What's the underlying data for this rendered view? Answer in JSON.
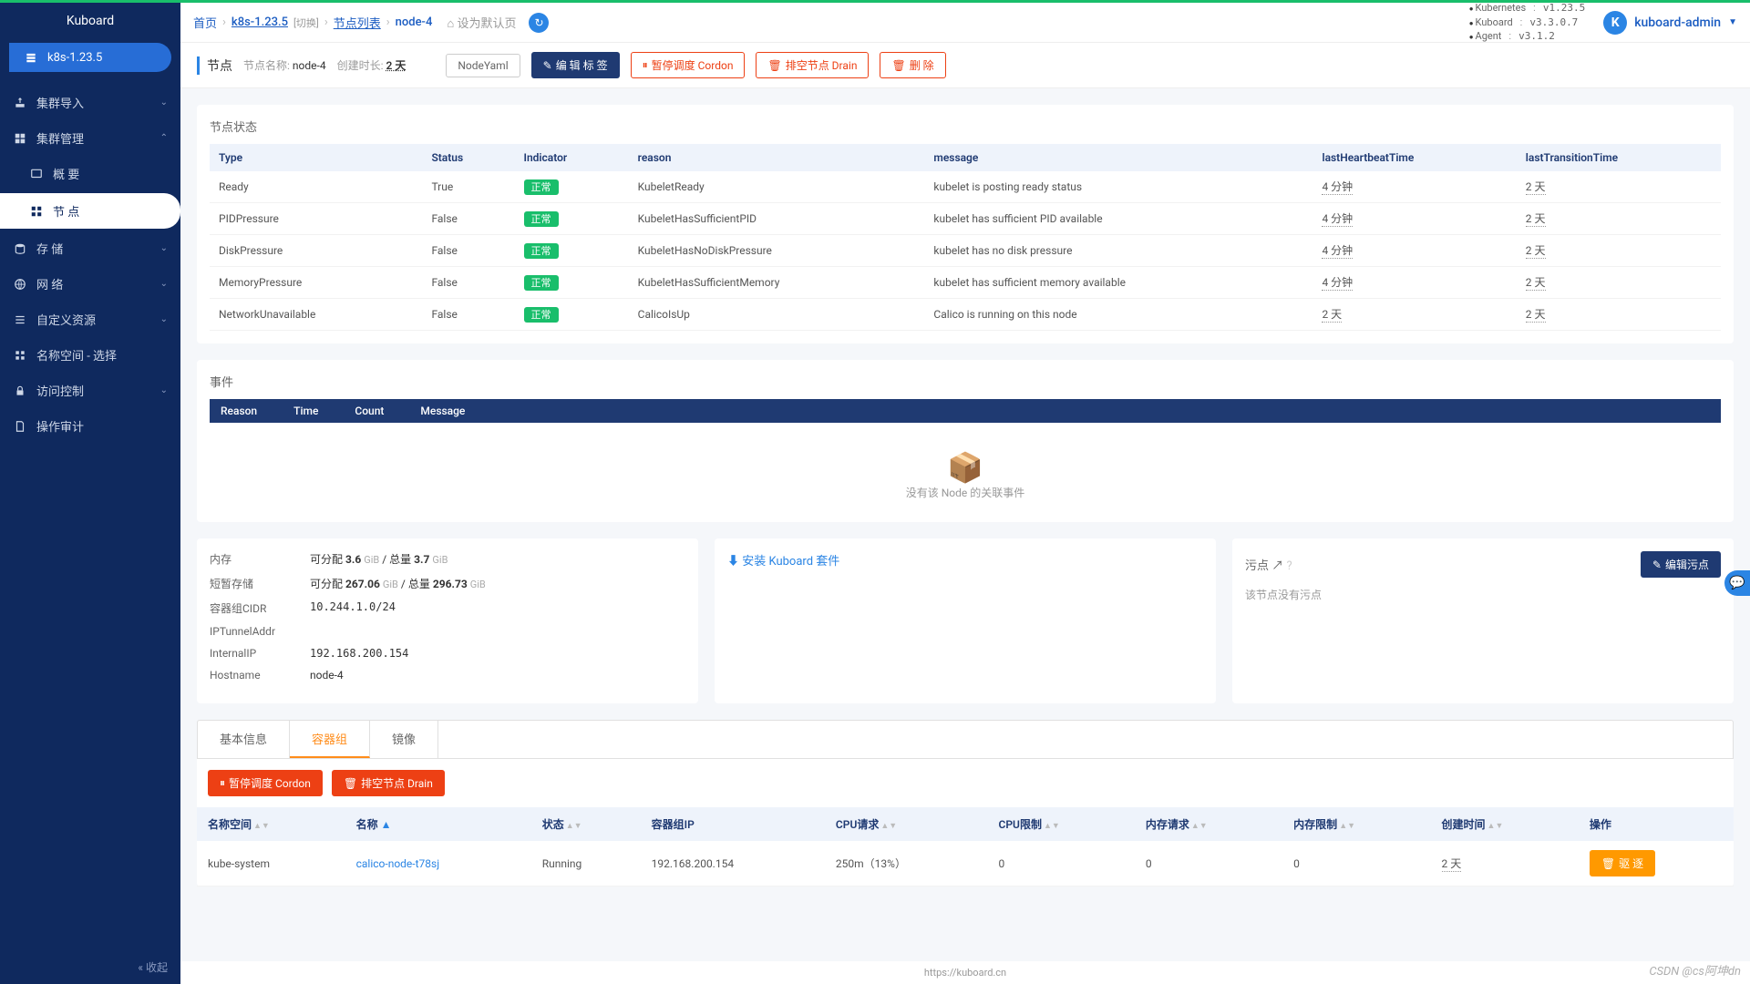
{
  "brand": "Kuboard",
  "sidebar": {
    "clusterItem": "k8s-1.23.5",
    "items": [
      {
        "label": "集群导入",
        "hasChildren": true
      },
      {
        "label": "集群管理",
        "hasChildren": true,
        "expanded": true,
        "children": [
          {
            "label": "概 要"
          },
          {
            "label": "节 点",
            "active": true
          }
        ]
      },
      {
        "label": "存 储",
        "hasChildren": true
      },
      {
        "label": "网 络",
        "hasChildren": true
      },
      {
        "label": "自定义资源",
        "hasChildren": true
      },
      {
        "label": "名称空间 - 选择",
        "hasChildren": false
      },
      {
        "label": "访问控制",
        "hasChildren": true
      },
      {
        "label": "操作审计",
        "hasChildren": false
      }
    ],
    "collapse": "收起"
  },
  "breadcrumb": {
    "home": "首页",
    "cluster": "k8s-1.23.5",
    "switch": "[切换]",
    "nodeList": "节点列表",
    "node": "node-4",
    "setDefault": "设为默认页"
  },
  "versions": [
    {
      "k": "Kubernetes",
      "v": "v1.23.5"
    },
    {
      "k": "Kuboard",
      "v": "v3.3.0.7"
    },
    {
      "k": "Agent",
      "v": "v3.1.2"
    }
  ],
  "user": {
    "initial": "K",
    "name": "kuboard-admin"
  },
  "toolbar": {
    "title": "节点",
    "nodeNameLabel": "节点名称:",
    "nodeName": "node-4",
    "createdLabel": "创建时长:",
    "createdValue": "2 天",
    "btnYaml": "NodeYaml",
    "btnEditLabel": "编 辑 标 签",
    "btnCordon": "暂停调度 Cordon",
    "btnDrain": "排空节点 Drain",
    "btnDelete": "删 除"
  },
  "status": {
    "title": "节点状态",
    "headers": [
      "Type",
      "Status",
      "Indicator",
      "reason",
      "message",
      "lastHeartbeatTime",
      "lastTransitionTime"
    ],
    "rows": [
      {
        "type": "Ready",
        "status": "True",
        "indicator": "正常",
        "reason": "KubeletReady",
        "message": "kubelet is posting ready status",
        "heartbeat": "4 分钟",
        "transition": "2 天"
      },
      {
        "type": "PIDPressure",
        "status": "False",
        "indicator": "正常",
        "reason": "KubeletHasSufficientPID",
        "message": "kubelet has sufficient PID available",
        "heartbeat": "4 分钟",
        "transition": "2 天"
      },
      {
        "type": "DiskPressure",
        "status": "False",
        "indicator": "正常",
        "reason": "KubeletHasNoDiskPressure",
        "message": "kubelet has no disk pressure",
        "heartbeat": "4 分钟",
        "transition": "2 天"
      },
      {
        "type": "MemoryPressure",
        "status": "False",
        "indicator": "正常",
        "reason": "KubeletHasSufficientMemory",
        "message": "kubelet has sufficient memory available",
        "heartbeat": "4 分钟",
        "transition": "2 天"
      },
      {
        "type": "NetworkUnavailable",
        "status": "False",
        "indicator": "正常",
        "reason": "CalicoIsUp",
        "message": "Calico is running on this node",
        "heartbeat": "2 天",
        "transition": "2 天"
      }
    ]
  },
  "events": {
    "title": "事件",
    "headers": [
      "Reason",
      "Time",
      "Count",
      "Message"
    ],
    "emptyText": "没有该 Node 的关联事件"
  },
  "info": {
    "memory": {
      "label": "内存",
      "alloc": "可分配",
      "allocVal": "3.6",
      "allocUnit": "GiB",
      "totalLabel": "/ 总量",
      "totalVal": "3.7",
      "totalUnit": "GiB"
    },
    "storage": {
      "label": "短暂存储",
      "alloc": "可分配",
      "allocVal": "267.06",
      "allocUnit": "GiB",
      "totalLabel": "/ 总量",
      "totalVal": "296.73",
      "totalUnit": "GiB"
    },
    "cidr": {
      "label": "容器组CIDR",
      "val": "10.244.1.0/24"
    },
    "iptunnel": {
      "label": "IPTunnelAddr",
      "val": ""
    },
    "internalIP": {
      "label": "InternalIP",
      "val": "192.168.200.154"
    },
    "hostname": {
      "label": "Hostname",
      "val": "node-4"
    }
  },
  "kuboardSuite": {
    "title": "安装 Kuboard 套件"
  },
  "taints": {
    "title": "污点",
    "btnEdit": "编辑污点",
    "empty": "该节点没有污点"
  },
  "tabs": {
    "items": [
      "基本信息",
      "容器组",
      "镜像"
    ],
    "active": 1
  },
  "pods": {
    "btnCordon": "暂停调度 Cordon",
    "btnDrain": "排空节点 Drain",
    "headers": [
      "名称空间",
      "名称",
      "状态",
      "容器组IP",
      "CPU请求",
      "CPU限制",
      "内存请求",
      "内存限制",
      "创建时间",
      "操作"
    ],
    "row": {
      "ns": "kube-system",
      "name": "calico-node-t78sj",
      "status": "Running",
      "ip": "192.168.200.154",
      "cpuReq": "250m（13%）",
      "cpuLim": "0",
      "memReq": "0",
      "memLim": "0",
      "created": "2 天",
      "action": "驱 逐"
    }
  },
  "footerUrl": "https://kuboard.cn",
  "watermark": "CSDN @cs阿坤dn"
}
